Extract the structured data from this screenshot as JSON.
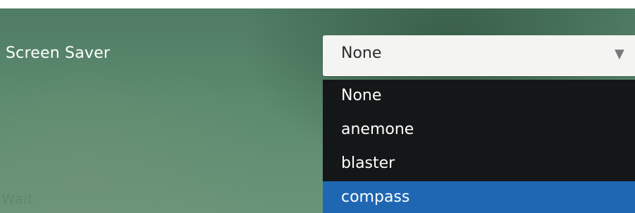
{
  "screen_saver": {
    "label": "Screen Saver",
    "selected_value": "None",
    "arrow_icon": "▼",
    "options": [
      "None",
      "anemone",
      "blaster",
      "compass"
    ],
    "highlighted_option": "compass"
  },
  "wait": {
    "label": "Wait"
  },
  "colors": {
    "highlight": "#1f67b3",
    "dropdown_bg": "#151617"
  }
}
